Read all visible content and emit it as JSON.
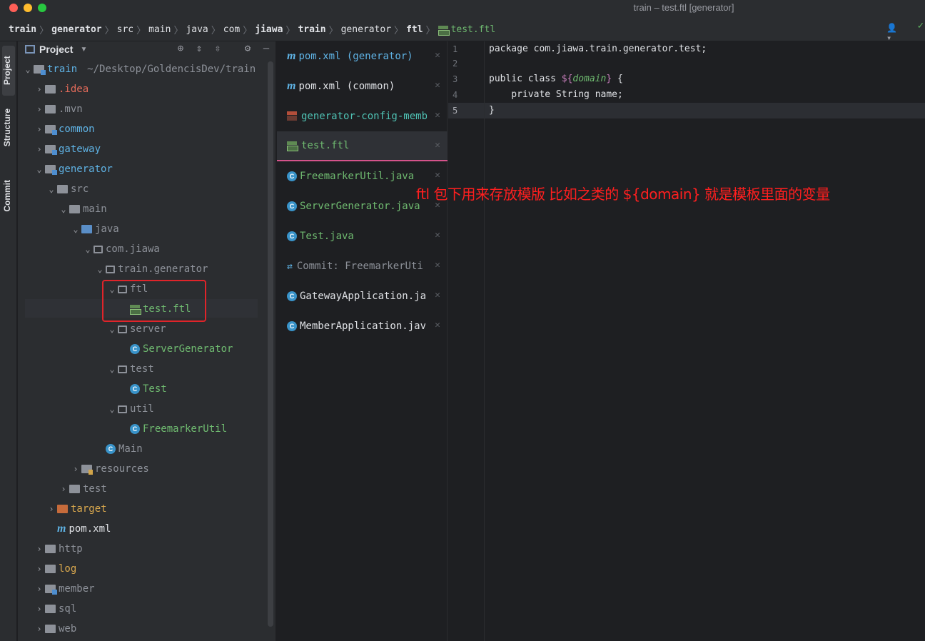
{
  "window": {
    "title": "train – test.ftl [generator]"
  },
  "breadcrumbs": [
    "train",
    "generator",
    "src",
    "main",
    "java",
    "com",
    "jiawa",
    "train",
    "generator",
    "ftl",
    "test.ftl"
  ],
  "toolstrip": {
    "project": "Project",
    "structure": "Structure",
    "commit": "Commit"
  },
  "project_panel": {
    "title": "Project",
    "root_name": "train",
    "root_path": "~/Desktop/GoldencisDev/train",
    "tree": {
      "idea": ".idea",
      "mvn": ".mvn",
      "common": "common",
      "gateway": "gateway",
      "generator": "generator",
      "src": "src",
      "main": "main",
      "java": "java",
      "com_jiawa": "com.jiawa",
      "train_generator": "train.generator",
      "ftl": "ftl",
      "test_ftl": "test.ftl",
      "server": "server",
      "server_generator": "ServerGenerator",
      "test_pkg": "test",
      "test_class": "Test",
      "util": "util",
      "freemarker_util": "FreemarkerUtil",
      "main_class": "Main",
      "resources": "resources",
      "test_dir": "test",
      "target": "target",
      "pom": "pom.xml",
      "http": "http",
      "log": "log",
      "member": "member",
      "sql": "sql",
      "web": "web"
    }
  },
  "tabs": [
    {
      "label": "pom.xml (generator)",
      "icon": "maven-icon"
    },
    {
      "label": "pom.xml (common)",
      "icon": "maven-icon"
    },
    {
      "label": "generator-config-memb",
      "icon": "generator-config-icon"
    },
    {
      "label": "test.ftl",
      "icon": "ftl-file-icon",
      "active": true
    },
    {
      "label": "FreemarkerUtil.java",
      "icon": "java-class-icon"
    },
    {
      "label": "ServerGenerator.java",
      "icon": "java-class-icon"
    },
    {
      "label": "Test.java",
      "icon": "java-class-icon"
    },
    {
      "label": "Commit: FreemarkerUti",
      "icon": "commit-icon"
    },
    {
      "label": "GatewayApplication.ja",
      "icon": "java-app-icon"
    },
    {
      "label": "MemberApplication.jav",
      "icon": "java-app-icon"
    }
  ],
  "editor": {
    "line_numbers": [
      "1",
      "2",
      "3",
      "4",
      "5"
    ],
    "line1": "package com.jiawa.train.generator.test;",
    "line3_prefix": "public class ",
    "line3_var_open": "${",
    "line3_var_name": "domain",
    "line3_var_close": "}",
    "line3_suffix": " {",
    "line4": "    private String name;",
    "line5": "}"
  },
  "annotation": "ftl 包下用来存放模版 比如之类的 ${domain} 就是模板里面的变量",
  "colors": {
    "accent": "#d5538b",
    "highlight_box": "#e0242a",
    "annotation": "#ff1f1f"
  }
}
